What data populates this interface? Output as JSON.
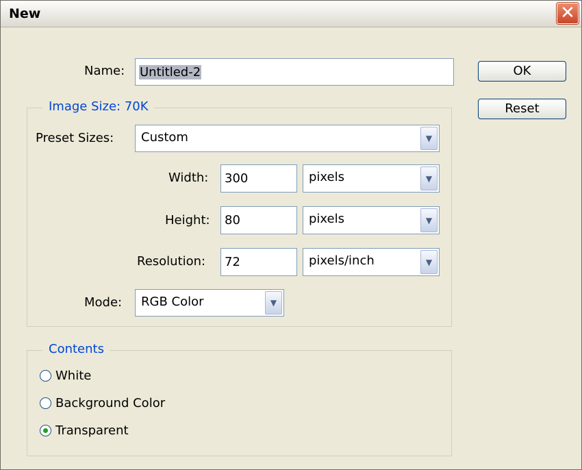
{
  "dialog": {
    "title": "New",
    "close_glyph": "✕"
  },
  "name": {
    "label": "Name:",
    "value": "Untitled-2"
  },
  "buttons": {
    "ok": "OK",
    "reset": "Reset"
  },
  "image_size": {
    "legend": "Image Size: 70K",
    "preset": {
      "label": "Preset Sizes:",
      "value": "Custom"
    },
    "width": {
      "label": "Width:",
      "value": "300",
      "unit": "pixels"
    },
    "height": {
      "label": "Height:",
      "value": "80",
      "unit": "pixels"
    },
    "resolution": {
      "label": "Resolution:",
      "value": "72",
      "unit": "pixels/inch"
    },
    "mode": {
      "label": "Mode:",
      "value": "RGB Color"
    }
  },
  "contents": {
    "legend": "Contents",
    "options": [
      {
        "label": "White",
        "checked": false
      },
      {
        "label": "Background Color",
        "checked": false
      },
      {
        "label": "Transparent",
        "checked": true
      }
    ]
  },
  "icons": {
    "dropdown": "chevron-down-icon",
    "close": "close-icon"
  },
  "colors": {
    "legend_text": "#0046d5",
    "close_button": "#c9462a",
    "radio_dot": "#21a121"
  }
}
